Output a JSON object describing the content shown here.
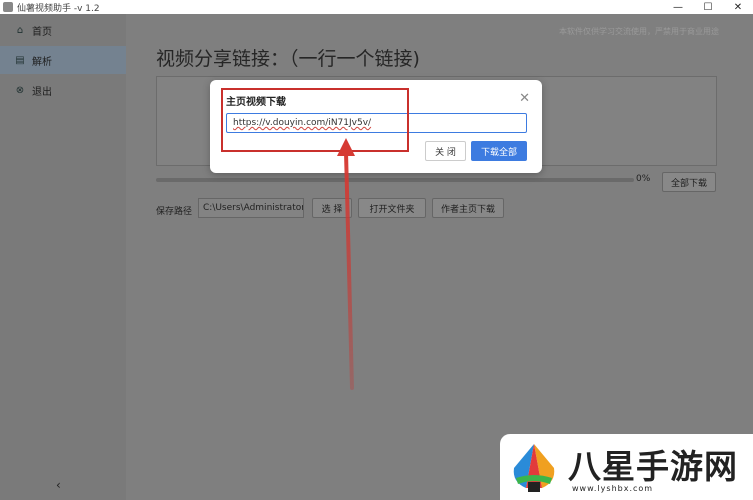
{
  "window": {
    "title": "仙薯视频助手 -v 1.2",
    "controls": {
      "minimize": "—",
      "maximize": "☐",
      "close": "✕"
    }
  },
  "sidebar": {
    "items": [
      {
        "label": "首页",
        "icon": "home-icon",
        "glyph": "⌂"
      },
      {
        "label": "解析",
        "icon": "document-icon",
        "glyph": "▤"
      },
      {
        "label": "退出",
        "icon": "exit-icon",
        "glyph": "⊗"
      }
    ],
    "collapse_glyph": "‹"
  },
  "main": {
    "notice": "本软件仅供学习交流使用，严禁用于商业用途",
    "title": "视频分享链接：（一行一个链接)",
    "progress_percent": "0%",
    "progress_value": 0,
    "download_all": "全部下载",
    "save_path_label": "保存路径",
    "save_path_value": "C:\\Users\\Administrator\\",
    "choose_button": "选 择",
    "open_folder_button": "打开文件夹",
    "author_home_button": "作者主页下载"
  },
  "dialog": {
    "title": "主页视频下载",
    "close_glyph": "✕",
    "input_value": "https://v.douyin.com/iN71Jv5v/",
    "close_button": "关 闭",
    "download_all_button": "下载全部"
  },
  "watermark": {
    "text": "八星手游网",
    "url": "www.lyshbx.com"
  },
  "colors": {
    "accent": "#3d7be0",
    "annotation": "#c9302c"
  }
}
